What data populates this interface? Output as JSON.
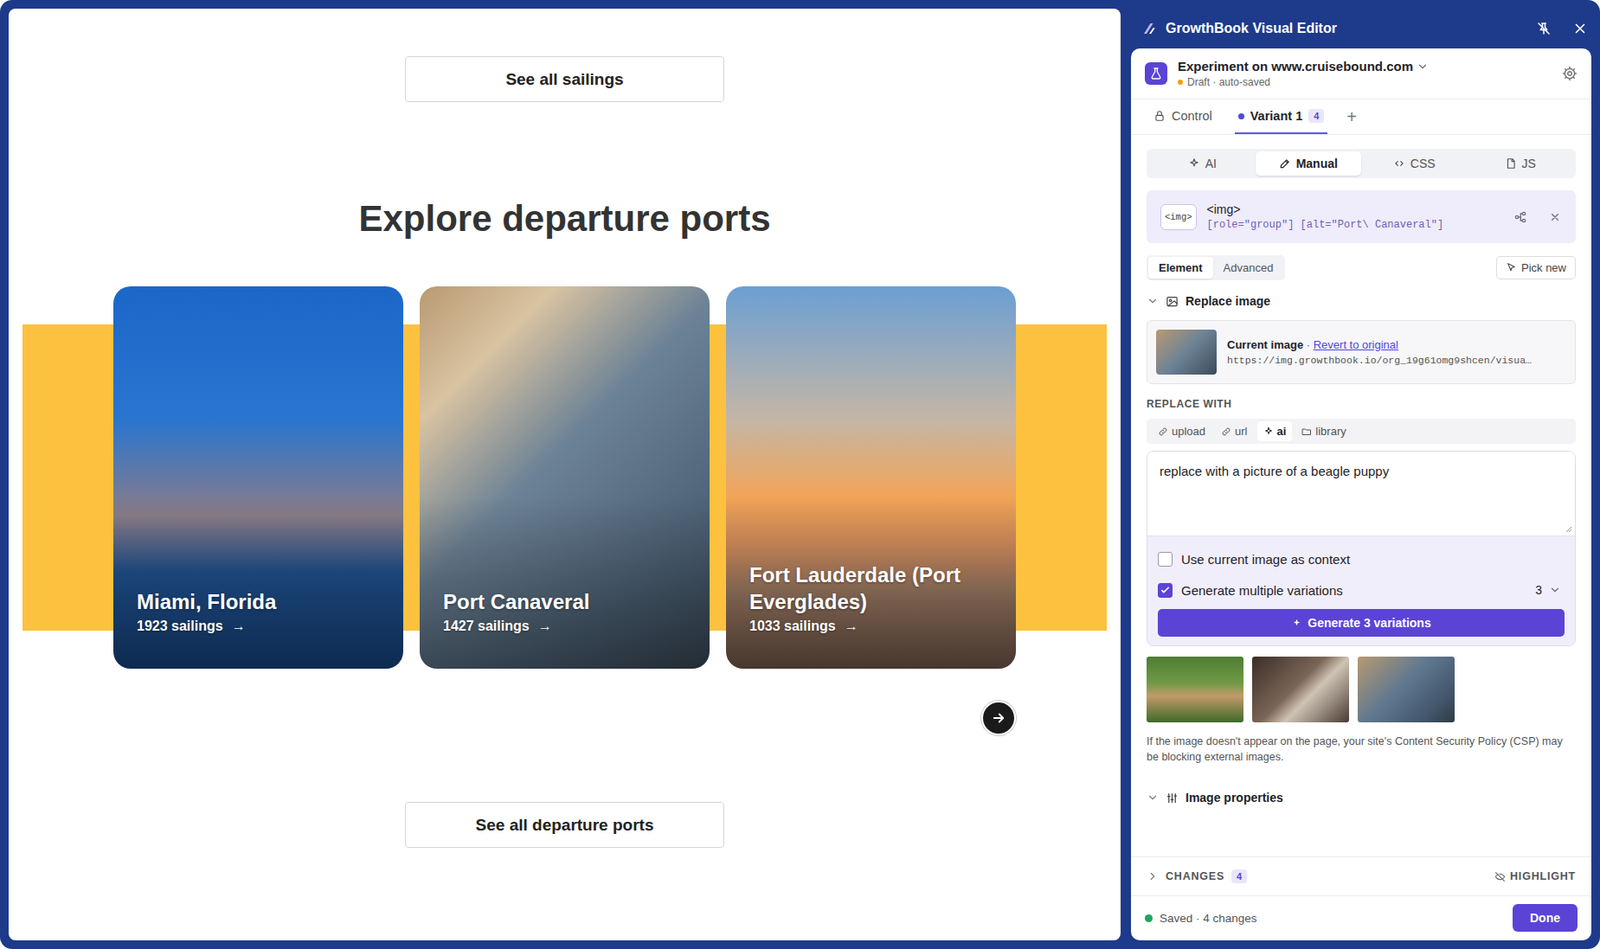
{
  "page": {
    "top_button": "See all sailings",
    "heading": "Explore departure ports",
    "cards": [
      {
        "name": "Miami, Florida",
        "count": "1923 sailings",
        "arrow": "→"
      },
      {
        "name": "Port Canaveral",
        "count": "1427 sailings",
        "arrow": "→"
      },
      {
        "name": "Fort Lauderdale (Port Everglades)",
        "count": "1033 sailings",
        "arrow": "→"
      }
    ],
    "bottom_button": "See all departure ports"
  },
  "editor": {
    "title": "GrowthBook Visual Editor",
    "experiment": {
      "name": "Experiment on www.cruisebound.com",
      "status": "Draft · auto-saved"
    },
    "variants": [
      {
        "label": "Control",
        "kind": "control",
        "selected": false
      },
      {
        "label": "Variant 1",
        "kind": "variant",
        "badge": "4",
        "selected": true
      }
    ],
    "add_variant": "+",
    "modes": [
      {
        "label": "AI",
        "selected": false
      },
      {
        "label": "Manual",
        "selected": true
      },
      {
        "label": "CSS",
        "selected": false
      },
      {
        "label": "JS",
        "selected": false
      }
    ],
    "selection": {
      "tag_icon": "<img>",
      "tag": "<img>",
      "selector": "[role=\"group\"] [alt=\"Port\\ Canaveral\"]"
    },
    "element_tabs": [
      {
        "label": "Element",
        "selected": true
      },
      {
        "label": "Advanced",
        "selected": false
      }
    ],
    "pick_new": "Pick new",
    "replace_section": {
      "title": "Replace image",
      "expanded": true
    },
    "current_image": {
      "label": "Current image",
      "separator": " · ",
      "revert": "Revert to original",
      "url": "https://img.growthbook.io/org_19g61omg9shcen/visua…"
    },
    "replace_with": "REPLACE WITH",
    "sources": [
      {
        "label": "upload",
        "selected": false
      },
      {
        "label": "url",
        "selected": false
      },
      {
        "label": "ai",
        "selected": true
      },
      {
        "label": "library",
        "selected": false
      }
    ],
    "prompt": "replace with a picture of a beagle puppy",
    "options": [
      {
        "label": "Use current image as context",
        "checked": false
      },
      {
        "label": "Generate multiple variations",
        "checked": true,
        "count": "3"
      }
    ],
    "generate_button": "Generate 3 variations",
    "csp_note": "If the image doesn't appear on the page, your site's Content Security Policy (CSP) may be blocking external images.",
    "properties_section": {
      "title": "Image properties",
      "expanded": true
    },
    "changes": {
      "label": "CHANGES",
      "count": "4",
      "expanded": false
    },
    "highlight": "HIGHLIGHT",
    "save_status": "Saved · 4 changes",
    "done_button": "Done"
  }
}
